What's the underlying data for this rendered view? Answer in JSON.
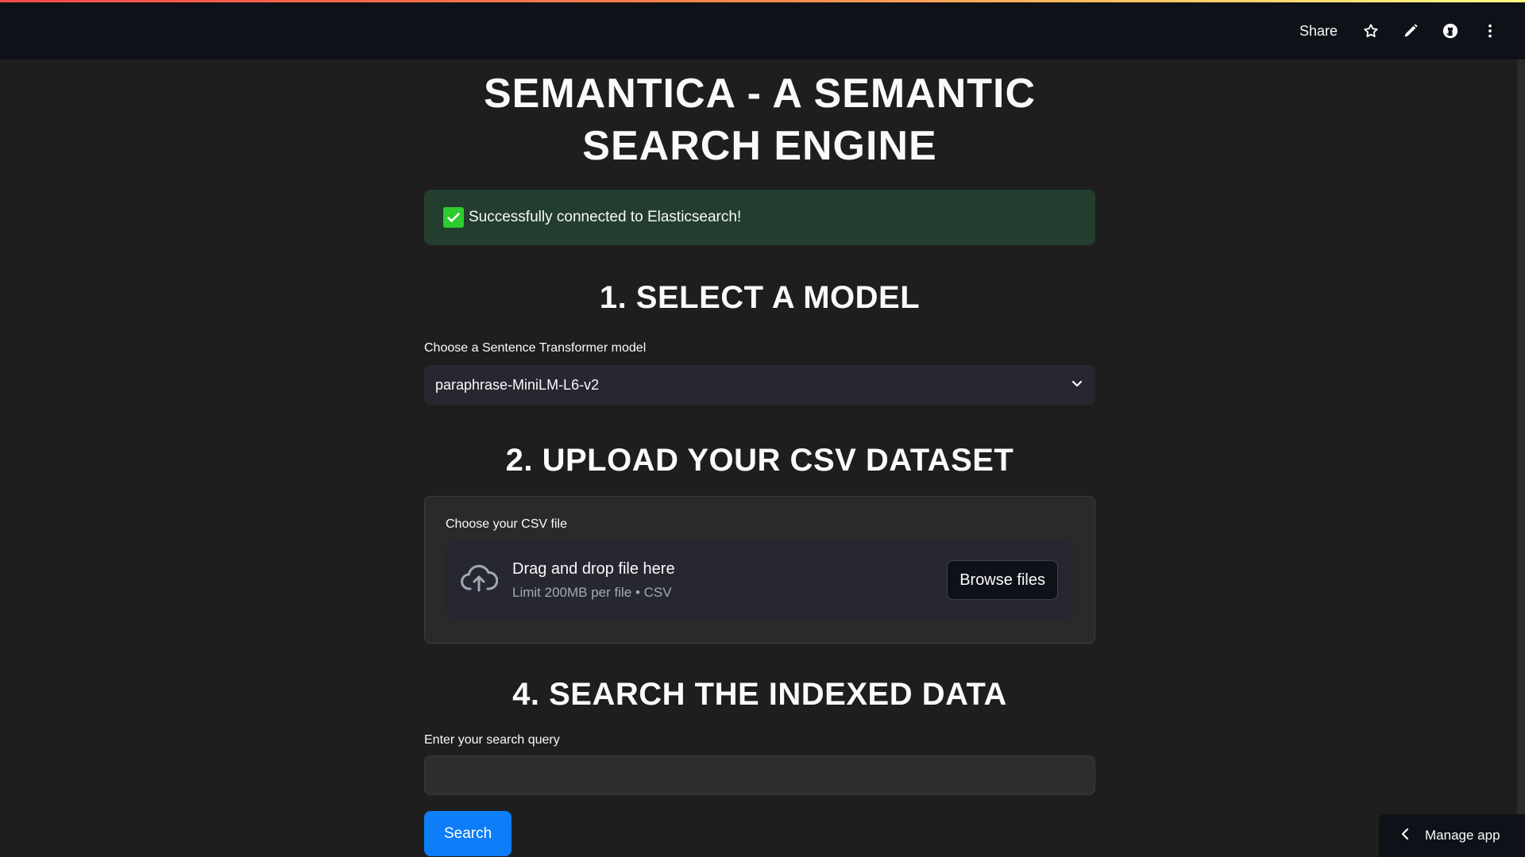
{
  "header": {
    "share_label": "Share",
    "icons": [
      "star-icon",
      "pencil-icon",
      "github-icon",
      "kebab-menu-icon"
    ]
  },
  "page": {
    "title_line1": "SEMANTICA - A SEMANTIC",
    "title_line2": "SEARCH ENGINE"
  },
  "alert": {
    "message": "Successfully connected to Elasticsearch!",
    "color": "#233d2e"
  },
  "model_section": {
    "heading": "1. SELECT A MODEL",
    "label": "Choose a Sentence Transformer model",
    "selected": "paraphrase-MiniLM-L6-v2"
  },
  "upload_section": {
    "heading": "2. UPLOAD YOUR CSV DATASET",
    "label": "Choose your CSV file",
    "drop_text": "Drag and drop file here",
    "limit_text": "Limit 200MB per file • CSV",
    "browse_label": "Browse files"
  },
  "search_section": {
    "heading": "4. SEARCH THE INDEXED DATA",
    "label": "Enter your search query",
    "query": "",
    "button_label": "Search",
    "button_color": "#0d7df8"
  },
  "footer": {
    "manage_label": "Manage app"
  }
}
